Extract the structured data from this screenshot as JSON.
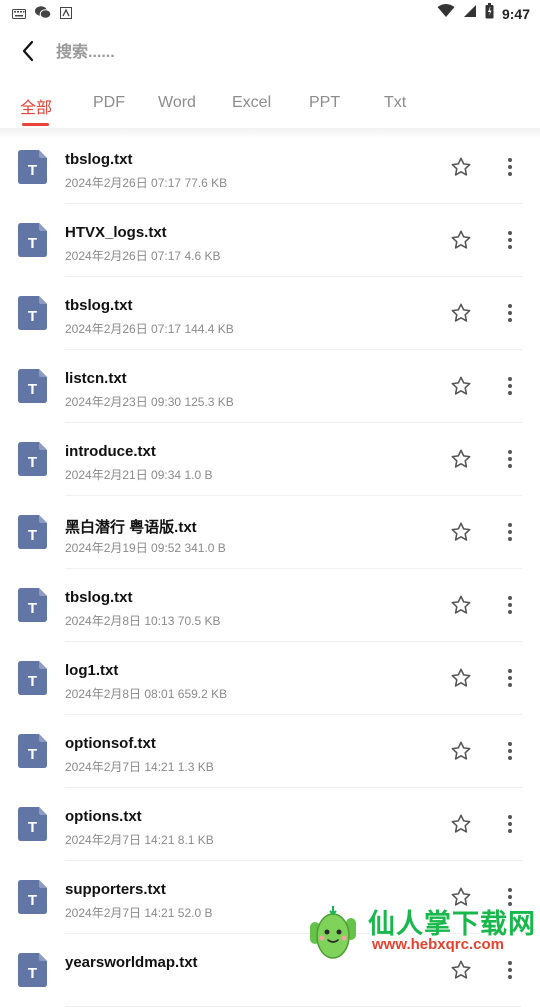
{
  "status_bar": {
    "time": "9:47",
    "left_icons": [
      "keyboard-icon",
      "wechat-icon",
      "app-icon"
    ],
    "right_icons": [
      "wifi-icon",
      "signal-icon",
      "battery-icon"
    ]
  },
  "header": {
    "search_placeholder": "搜索......",
    "back_icon": "chevron-left-icon"
  },
  "tabs": [
    {
      "label": "全部",
      "active": true
    },
    {
      "label": "PDF",
      "active": false
    },
    {
      "label": "Word",
      "active": false
    },
    {
      "label": "Excel",
      "active": false
    },
    {
      "label": "PPT",
      "active": false
    },
    {
      "label": "Txt",
      "active": false
    }
  ],
  "files": [
    {
      "name": "tbslog.txt",
      "date": "2024年2月26日 07:17",
      "size": "77.6 KB"
    },
    {
      "name": "HTVX_logs.txt",
      "date": "2024年2月26日 07:17",
      "size": "4.6 KB"
    },
    {
      "name": "tbslog.txt",
      "date": "2024年2月26日 07:17",
      "size": "144.4 KB"
    },
    {
      "name": "listcn.txt",
      "date": "2024年2月23日 09:30",
      "size": "125.3 KB"
    },
    {
      "name": "introduce.txt",
      "date": "2024年2月21日 09:34",
      "size": "1.0 B"
    },
    {
      "name": "黑白潜行 粤语版.txt",
      "date": "2024年2月19日 09:52",
      "size": "341.0 B"
    },
    {
      "name": "tbslog.txt",
      "date": "2024年2月8日 10:13",
      "size": "70.5 KB"
    },
    {
      "name": "log1.txt",
      "date": "2024年2月8日 08:01",
      "size": "659.2 KB"
    },
    {
      "name": "optionsof.txt",
      "date": "2024年2月7日 14:21",
      "size": "1.3 KB"
    },
    {
      "name": "options.txt",
      "date": "2024年2月7日 14:21",
      "size": "8.1 KB"
    },
    {
      "name": "supporters.txt",
      "date": "2024年2月7日 14:21",
      "size": "52.0 B"
    },
    {
      "name": "yearsworldmap.txt",
      "date": "",
      "size": ""
    }
  ],
  "file_icon": {
    "glyph": "T",
    "color": "#6276a6"
  },
  "colors": {
    "accent": "#e8443a",
    "icon_blue": "#6276a6"
  },
  "watermark": {
    "text": "仙人掌下载网",
    "url": "www.hebxqrc.com"
  }
}
